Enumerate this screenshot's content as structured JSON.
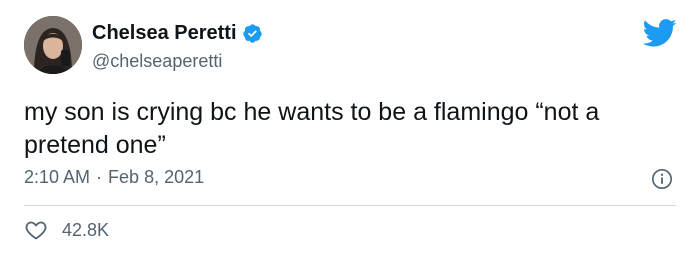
{
  "user": {
    "display_name": "Chelsea Peretti",
    "handle": "@chelseaperetti",
    "verified": true
  },
  "tweet": {
    "text": "my son is crying bc he wants to be a flamingo “not a pretend one”",
    "time": "2:10 AM",
    "separator": "·",
    "date": "Feb 8, 2021"
  },
  "engagement": {
    "likes": "42.8K"
  },
  "icons": {
    "verified": "verified-badge-icon",
    "brand": "twitter-bird-icon",
    "info": "info-icon",
    "like": "heart-icon"
  },
  "colors": {
    "brand_blue": "#1d9bf0",
    "text_primary": "#0f1419",
    "text_secondary": "#536471",
    "divider": "#cfd9de"
  }
}
